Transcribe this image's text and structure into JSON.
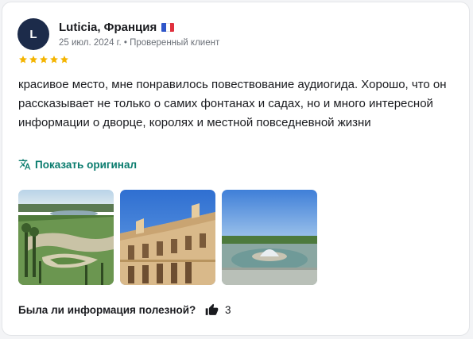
{
  "review": {
    "avatar_initial": "L",
    "author": "Luticia, Франция",
    "flag_icon": "flag-france-icon",
    "flag_colors": [
      "#2f56c9",
      "#ffffff",
      "#e0303e"
    ],
    "date": "25 июл. 2024 г.",
    "separator": "•",
    "badge": "Проверенный клиент",
    "rating": 5,
    "star_color": "#f4b400",
    "text": "красивое место, мне понравилось повествование аудиогида. Хорошо, что он рассказывает не только о самих фонтанах и садах, но и много интересной информации о дворце, королях и местной повседневной жизни",
    "show_original": "Показать оригинал",
    "translate_icon": "translate-icon",
    "photos": [
      "photo-gardens",
      "photo-palace-facade",
      "photo-fountain-basin"
    ]
  },
  "footer": {
    "helpful_question": "Была ли информация полезной?",
    "like_icon": "thumbs-up-icon",
    "like_count": "3"
  }
}
